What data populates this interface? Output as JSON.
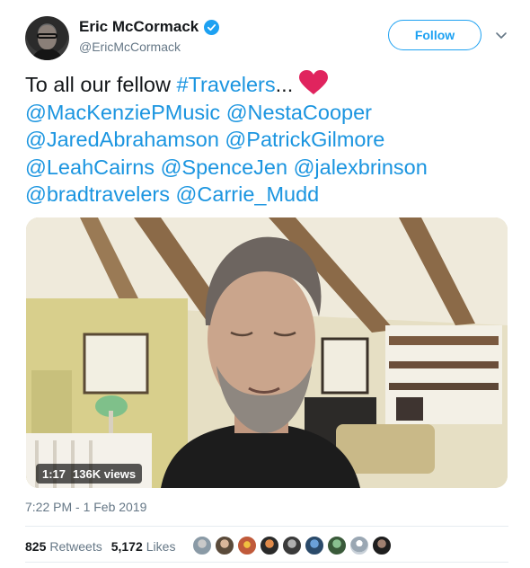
{
  "author": {
    "display_name": "Eric McCormack",
    "handle": "@EricMcCormack",
    "verified": true
  },
  "follow_label": "Follow",
  "tweet": {
    "intro": "To all our fellow ",
    "hashtag": "#Travelers",
    "ellipsis": "...",
    "mentions": [
      "@MacKenziePMusic",
      "@NestaCooper",
      "@JaredAbrahamson",
      "@PatrickGilmore",
      "@LeahCairns",
      "@SpenceJen",
      "@jalexbrinson",
      "@bradtravelers",
      "@Carrie_Mudd"
    ]
  },
  "video": {
    "duration": "1:17",
    "views": "136K views"
  },
  "timestamp": "7:22 PM - 1 Feb 2019",
  "stats": {
    "retweets_count": "825",
    "retweets_label": "Retweets",
    "likes_count": "5,172",
    "likes_label": "Likes"
  },
  "likers_count": 9,
  "colors": {
    "link": "#1b95e0",
    "accent": "#1da1f2",
    "heart": "#e0245e",
    "secondary_text": "#657786"
  },
  "icons": [
    "verified-icon",
    "caret-down-icon",
    "red-heart-icon"
  ]
}
